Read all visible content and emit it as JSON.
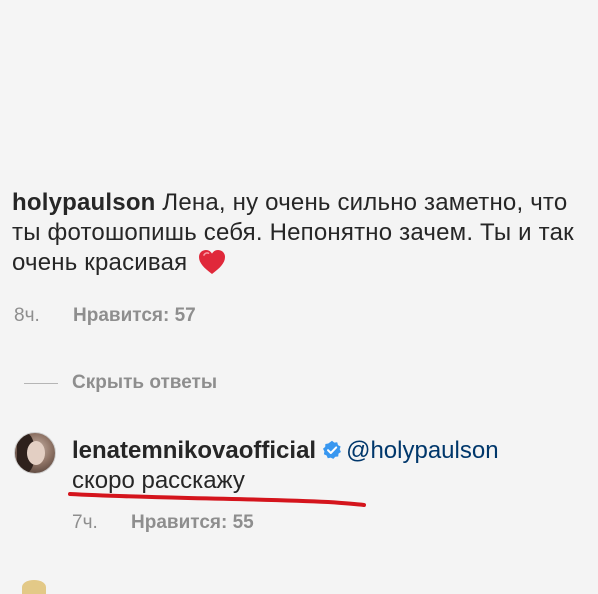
{
  "comment": {
    "username": "holypaulson",
    "text": "Лена, ну очень сильно заметно, что ты фотошопишь себя. Непонятно зачем. Ты и так очень красивая",
    "time": "8ч.",
    "likes": "Нравится: 57"
  },
  "hide_replies": {
    "label": "Скрыть ответы"
  },
  "reply": {
    "username": "lenatemnikovaofficial",
    "mention": "@holypaulson",
    "text": "скоро расскажу",
    "time": "7ч.",
    "likes": "Нравится: 55"
  },
  "colors": {
    "heart": "#e0283a",
    "verified": "#3897f0",
    "underline": "#d4141c",
    "meta": "#8e8e8e"
  },
  "icons": {
    "heart": "red-heart-emoji",
    "verified": "verified-badge-icon"
  }
}
